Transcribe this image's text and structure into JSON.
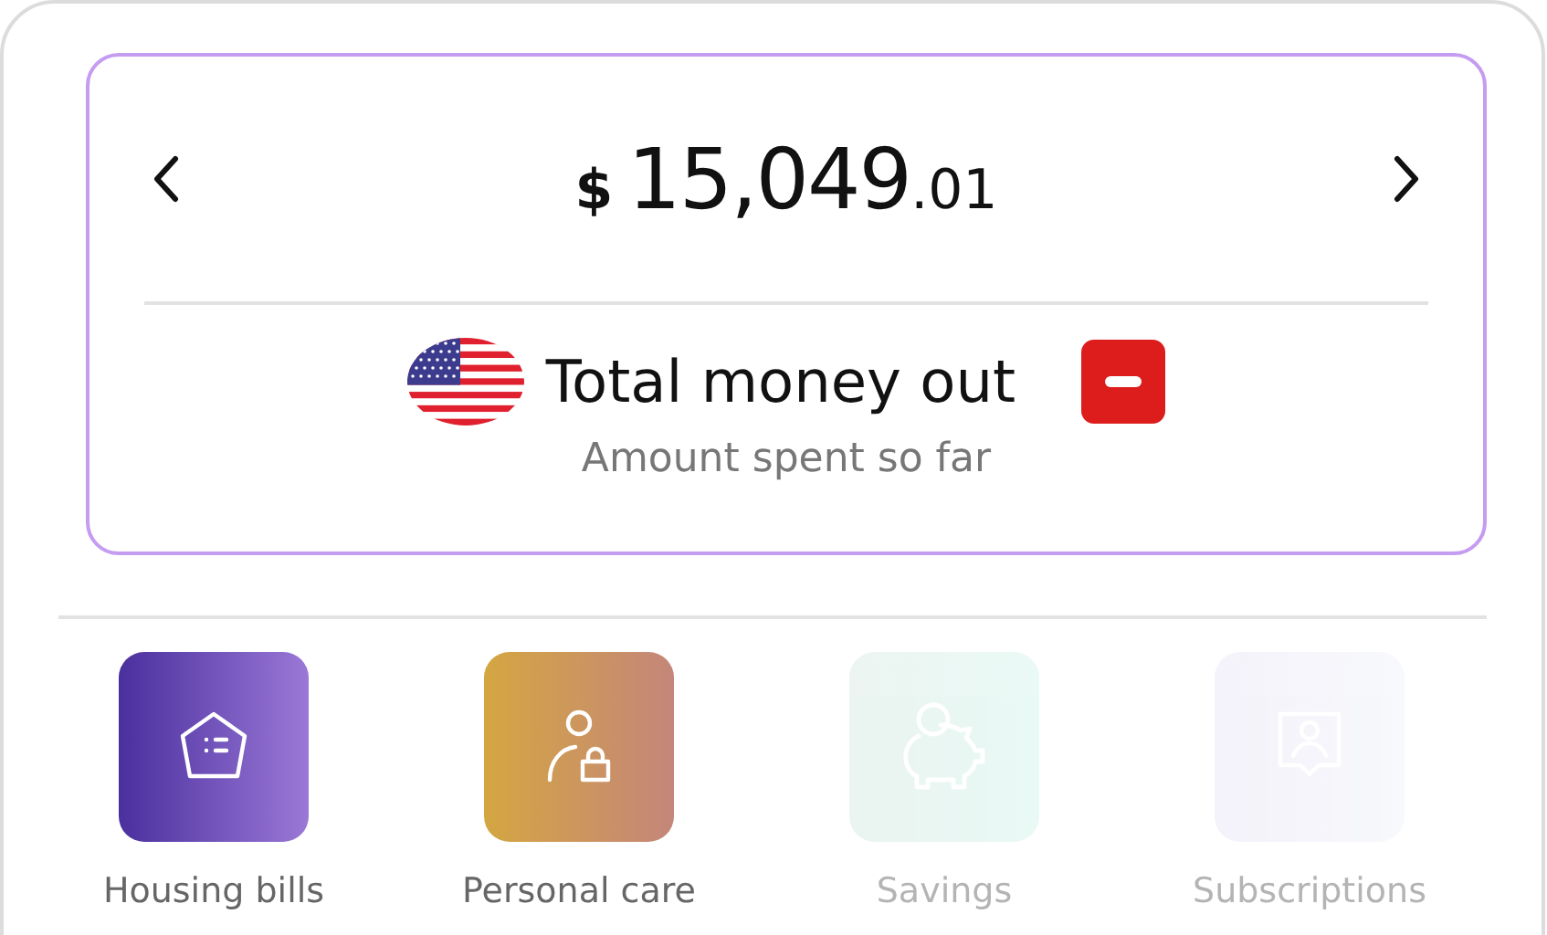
{
  "summary": {
    "currency_symbol": "$",
    "amount_whole": "15,049",
    "amount_cents": ".01",
    "title": "Total money out",
    "subtitle": "Amount spent so far"
  },
  "categories": [
    {
      "label": "Housing bills",
      "kind": "house",
      "disabled": false
    },
    {
      "label": "Personal care",
      "kind": "person",
      "disabled": false
    },
    {
      "label": "Savings",
      "kind": "piggy",
      "disabled": true
    },
    {
      "label": "Subscriptions",
      "kind": "profile",
      "disabled": true
    }
  ]
}
